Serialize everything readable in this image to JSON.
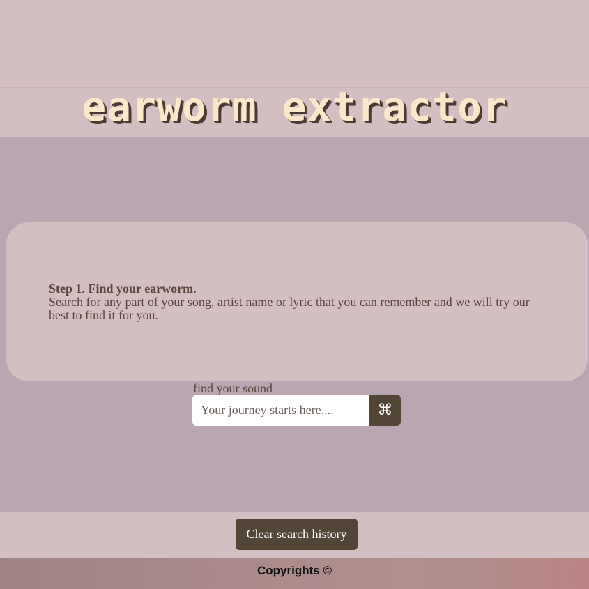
{
  "header": {
    "title": "earworm extractor"
  },
  "info_card": {
    "step": "Step 1. Find your earworm.",
    "description": "Search for any part of your song, artist name or lyric that you can remember and we will try our best to find it for you."
  },
  "search": {
    "label": "find your sound",
    "placeholder": "Your journey starts here....",
    "value": "",
    "button_icon": "command-icon",
    "button_glyph": "⌘"
  },
  "actions": {
    "clear_label": "Clear search history"
  },
  "footer": {
    "copyright": "Copyrights ©"
  },
  "colors": {
    "header_bg": "#d3bec2",
    "main_bg": "#b9a6b0",
    "title_fill": "#fbe8cb",
    "title_shadow": "#4a3b31",
    "button_bg": "#544637",
    "text": "#5a453d"
  }
}
